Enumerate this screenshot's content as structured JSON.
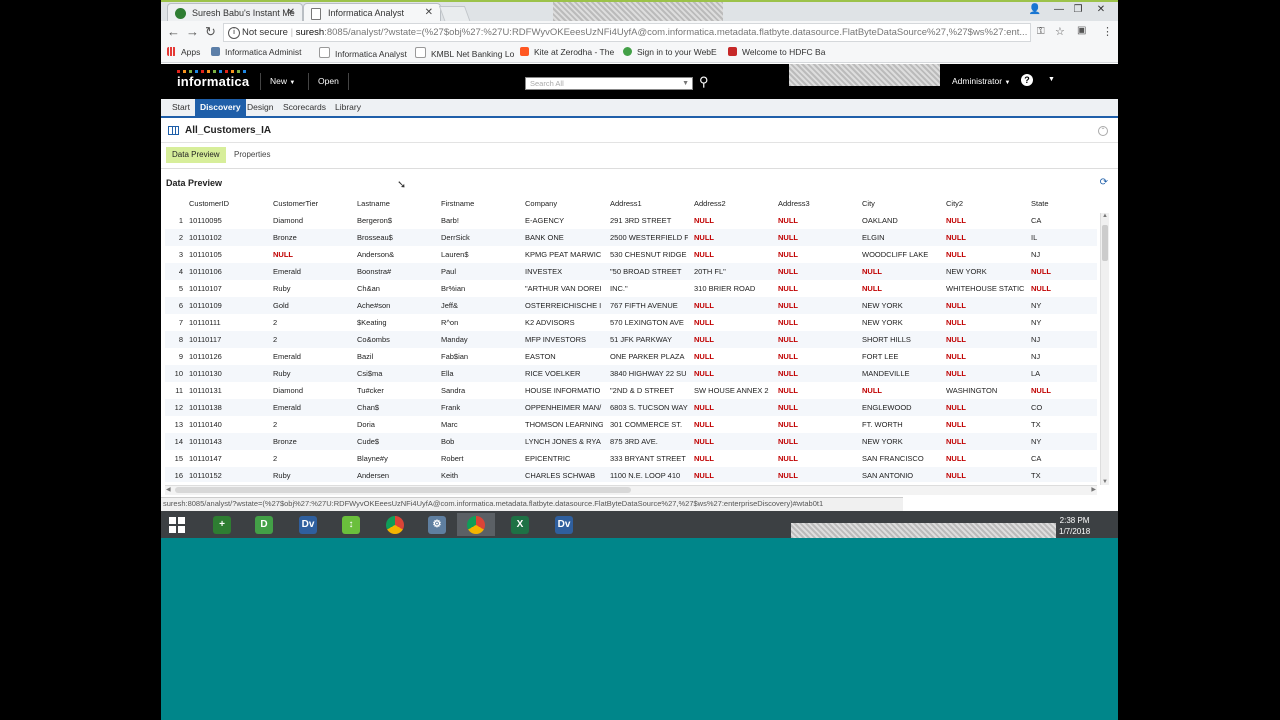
{
  "browser": {
    "tabs": [
      {
        "title": "Suresh Babu's Instant Me",
        "favicon_color": "#2e7d32"
      },
      {
        "title": "Informatica Analyst",
        "favicon_color": "#9e9e9e"
      }
    ],
    "window_controls": {
      "minimize": "—",
      "restore": "❐",
      "close": "✕"
    },
    "security_label": "Not secure",
    "url_host": "suresh",
    "url_rest": ":8085/analyst/?wstate=(%27$obj%27:%27U:RDFWyvOKEeesUzNFi4UyfA@com.informatica.metadata.flatbyte.datasource.FlatByteDataSource%27,%27$ws%27:ent...",
    "bookmarks": [
      {
        "label": "Apps",
        "color": "#888888"
      },
      {
        "label": "Informatica Administ",
        "color": "#5c7fa8"
      },
      {
        "label": "Informatica Analyst",
        "color": "#9e9e9e"
      },
      {
        "label": "KMBL Net Banking Lo",
        "color": "#444444"
      },
      {
        "label": "Kite at Zerodha - The",
        "color": "#ff5722"
      },
      {
        "label": "Sign in to your WebE",
        "color": "#43a047"
      },
      {
        "label": "Welcome to HDFC Ba",
        "color": "#c62828"
      }
    ]
  },
  "app": {
    "brand": "informatica",
    "menu_new": "New",
    "menu_open": "Open",
    "search_placeholder": "Search All",
    "user": "Administrator",
    "help": "?",
    "workspace_tabs": [
      "Start",
      "Discovery",
      "Design",
      "Scorecards",
      "Library"
    ],
    "active_tab": "Discovery",
    "object_title": "All_Customers_IA",
    "sub_tabs": [
      "Data Preview",
      "Properties"
    ],
    "section_title": "Data Preview"
  },
  "grid": {
    "columns": [
      "CustomerID",
      "CustomerTier",
      "Lastname",
      "Firstname",
      "Company",
      "Address1",
      "Address2",
      "Address3",
      "City",
      "City2",
      "State"
    ],
    "rows": [
      [
        "1",
        "10110095",
        "Diamond",
        "Bergeron$",
        "Barb!",
        "E-AGENCY",
        "291 3RD STREET",
        "NULL",
        "NULL",
        "OAKLAND",
        "NULL",
        "CA"
      ],
      [
        "2",
        "10110102",
        "Bronze",
        "Brosseau$",
        "DerrSick",
        "BANK ONE",
        "2500 WESTERFIELD F",
        "NULL",
        "NULL",
        "ELGIN",
        "NULL",
        "IL"
      ],
      [
        "3",
        "10110105",
        "NULL",
        "Anderson&",
        "Lauren$",
        "KPMG PEAT MARWIC",
        "530 CHESNUT RIDGE",
        "NULL",
        "NULL",
        "WOODCLIFF LAKE",
        "NULL",
        "NJ"
      ],
      [
        "4",
        "10110106",
        "Emerald",
        "Boonstra#",
        "Paul",
        "INVESTEX",
        "\"50 BROAD STREET",
        "20TH FL\"",
        "NULL",
        "NULL",
        "NEW YORK",
        "NULL"
      ],
      [
        "5",
        "10110107",
        "Ruby",
        "Ch&an",
        "Br%ian",
        "\"ARTHUR VAN DOREI",
        "INC.\"",
        "310 BRIER ROAD",
        "NULL",
        "NULL",
        "WHITEHOUSE STATIC",
        "NULL"
      ],
      [
        "6",
        "10110109",
        "Gold",
        "Ache#son",
        "Jeff&",
        "OSTERREICHISCHE I",
        "767 FIFTH AVENUE",
        "NULL",
        "NULL",
        "NEW YORK",
        "NULL",
        "NY"
      ],
      [
        "7",
        "10110111",
        "2",
        "$Keating",
        "R^on",
        "K2 ADVISORS",
        "570 LEXINGTON AVE",
        "NULL",
        "NULL",
        "NEW YORK",
        "NULL",
        "NY"
      ],
      [
        "8",
        "10110117",
        "2",
        "Co&ombs",
        "Manday",
        "MFP INVESTORS",
        "51 JFK PARKWAY",
        "NULL",
        "NULL",
        "SHORT HILLS",
        "NULL",
        "NJ"
      ],
      [
        "9",
        "10110126",
        "Emerald",
        "Bazil",
        "Fab$ian",
        "EASTON",
        "ONE PARKER PLAZA",
        "NULL",
        "NULL",
        "FORT LEE",
        "NULL",
        "NJ"
      ],
      [
        "10",
        "10110130",
        "Ruby",
        "Csi$ma",
        "Ella",
        "RICE VOELKER",
        "3840 HIGHWAY 22  SU",
        "NULL",
        "NULL",
        "MANDEVILLE",
        "NULL",
        "LA"
      ],
      [
        "11",
        "10110131",
        "Diamond",
        "Tu#cker",
        "Sandra",
        "HOUSE INFORMATIO",
        "\"2ND & D STREET",
        "SW  HOUSE ANNEX 2",
        "NULL",
        "NULL",
        "WASHINGTON",
        "NULL"
      ],
      [
        "12",
        "10110138",
        "Emerald",
        "Chan$",
        "Frank",
        "OPPENHEIMER MAN/",
        "6803 S. TUCSON WAY",
        "NULL",
        "NULL",
        "ENGLEWOOD",
        "NULL",
        "CO"
      ],
      [
        "13",
        "10110140",
        "2",
        "Doria",
        "Marc",
        "THOMSON LEARNING",
        "301 COMMERCE ST.",
        "NULL",
        "NULL",
        "FT. WORTH",
        "NULL",
        "TX"
      ],
      [
        "14",
        "10110143",
        "Bronze",
        "Cude$",
        "Bob",
        "LYNCH JONES & RYA",
        "875 3RD AVE.",
        "NULL",
        "NULL",
        "NEW YORK",
        "NULL",
        "NY"
      ],
      [
        "15",
        "10110147",
        "2",
        "Blayne#y",
        "Robert",
        "EPICENTRIC",
        "333 BRYANT STREET",
        "NULL",
        "NULL",
        "SAN FRANCISCO",
        "NULL",
        "CA"
      ],
      [
        "16",
        "10110152",
        "Ruby",
        "Andersen",
        "Keith",
        "CHARLES SCHWAB",
        "1100 N.E. LOOP 410",
        "NULL",
        "NULL",
        "SAN ANTONIO",
        "NULL",
        "TX"
      ]
    ]
  },
  "status_url": "suresh:8085/analyst/?wstate=(%27$obj%27:%27U:RDFWyvOKEeesUzNFi4UyfA@com.informatica.metadata.flatbyte.datasource.FlatByteDataSource%27,%27$ws%27:enterpriseDiscovery)#wtab0t1",
  "taskbar": {
    "apps": [
      {
        "name": "gear-plus-app-icon",
        "label": "+",
        "color": "#2e7d32"
      },
      {
        "name": "d-app-icon",
        "label": "D",
        "color": "#43a047"
      },
      {
        "name": "dv-app-icon",
        "label": "Dv",
        "color": "#2f5f9e"
      },
      {
        "name": "updown-app-icon",
        "label": "↕",
        "color": "#6abf3c"
      },
      {
        "name": "chrome-icon",
        "label": "",
        "color": "#db4437"
      },
      {
        "name": "settings-app-icon",
        "label": "⚙",
        "color": "#5f7fa0"
      },
      {
        "name": "chrome-active-icon",
        "label": "",
        "color": "#db4437"
      },
      {
        "name": "excel-icon",
        "label": "X",
        "color": "#1e7145"
      },
      {
        "name": "dv-app-icon-2",
        "label": "Dv",
        "color": "#2f5f9e"
      }
    ],
    "time": "2:38 PM",
    "date": "1/7/2018"
  }
}
